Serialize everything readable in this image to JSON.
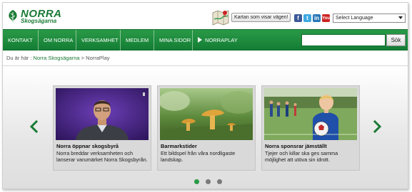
{
  "header": {
    "logo_main": "NORRA",
    "logo_sub": "Skogsägarna",
    "map_button": "Kartan som visar vägen!",
    "social_icons": [
      "facebook-icon",
      "twitter-icon",
      "linkedin-icon",
      "youtube-icon"
    ],
    "social_glyphs": {
      "facebook": "f",
      "twitter": "t",
      "linkedin": "in",
      "youtube": "You"
    },
    "language_select": "Select Language"
  },
  "nav": {
    "items": [
      {
        "label": "KONTAKT"
      },
      {
        "label": "OM NORRA"
      },
      {
        "label": "VERKSAMHET"
      },
      {
        "label": "MEDLEM"
      },
      {
        "label": "MINA SIDOR"
      },
      {
        "label": "NORRAPLAY"
      }
    ],
    "search_placeholder": "",
    "search_button": "Sök"
  },
  "breadcrumb": {
    "prefix": "Du är här :",
    "items": [
      "Norra Skogsägarna",
      "NorraPlay"
    ],
    "separator": ">"
  },
  "carousel": {
    "cards": [
      {
        "title": "Norra öppnar skogsbyrå",
        "description": "Norra breddar verksamheten och lanserar varumärket Norra Skogsbyrån."
      },
      {
        "title": "Barmarkstider",
        "description": "Ett bildspel från våra nordligaste landskap."
      },
      {
        "title": "Norra sponsrar jämställt",
        "description": "Tjejer och killar ska ges samma möjlighet att utöva sin idrott."
      }
    ],
    "pages": 3,
    "active_page": 1
  },
  "colors": {
    "brand_green": "#1a7a35",
    "nav_green": "#2a9a47"
  }
}
